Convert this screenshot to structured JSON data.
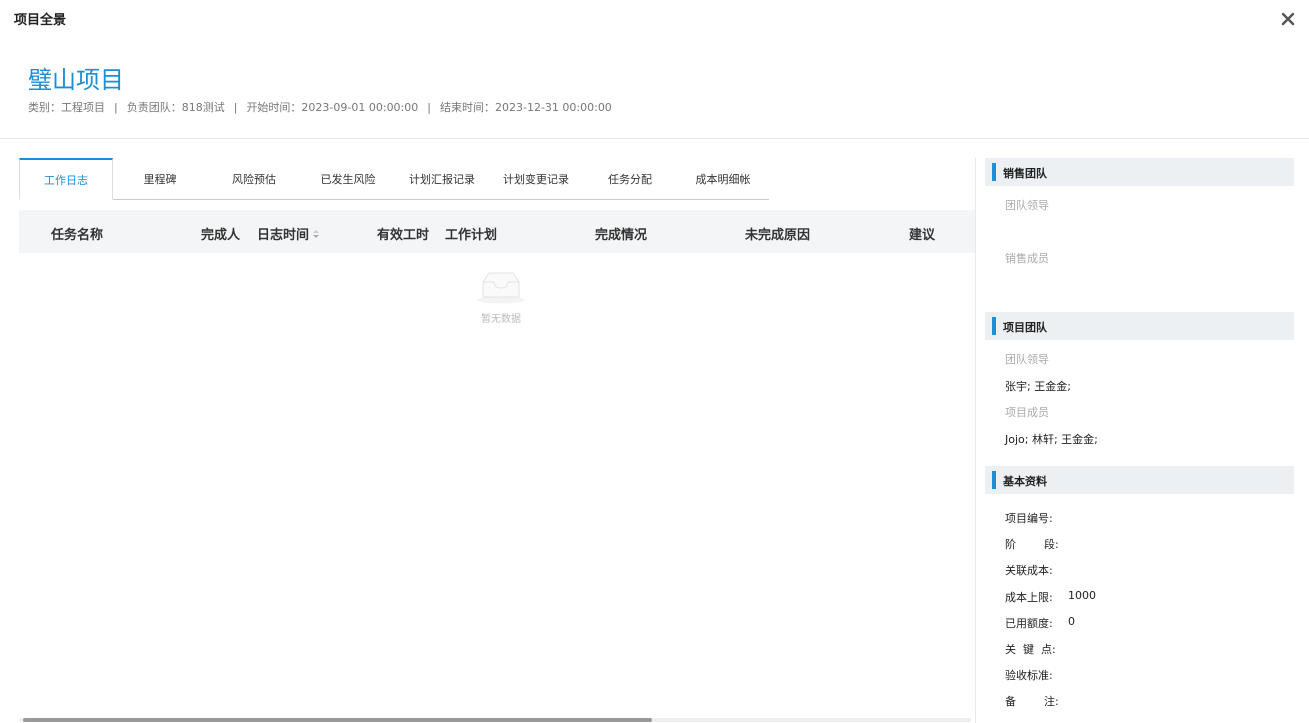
{
  "modal": {
    "title": "项目全景"
  },
  "project": {
    "name": "璧山项目",
    "meta": [
      "类别：工程项目",
      "负责团队：818测试",
      "开始时间：2023-09-01 00:00:00",
      "结束时间：2023-12-31 00:00:00"
    ],
    "separator": "|"
  },
  "tabs": [
    "工作日志",
    "里程碑",
    "风险预估",
    "已发生风险",
    "计划汇报记录",
    "计划变更记录",
    "任务分配",
    "成本明细帐"
  ],
  "table": {
    "columns": [
      "任务名称",
      "完成人",
      "日志时间",
      "有效工时",
      "工作计划",
      "完成情况",
      "未完成原因",
      "建议"
    ],
    "empty_text": "暂无数据"
  },
  "sidebar": {
    "sales_team": {
      "title": "销售团队",
      "leader_label": "团队领导",
      "leader_value": "",
      "members_label": "销售成员",
      "members_value": ""
    },
    "project_team": {
      "title": "项目团队",
      "leader_label": "团队领导",
      "leader_value": "张宇; 王金金;",
      "members_label": "项目成员",
      "members_value": "Jojo; 林轩; 王金金;"
    },
    "basic_info": {
      "title": "基本资料",
      "fields": [
        {
          "key": "项目编号:",
          "value": ""
        },
        {
          "key": "阶        段:",
          "value": ""
        },
        {
          "key": "关联成本:",
          "value": ""
        },
        {
          "key": "成本上限:",
          "value": "1000"
        },
        {
          "key": "已用额度:",
          "value": "0"
        },
        {
          "key": "关  键  点:",
          "value": ""
        },
        {
          "key": "验收标准:",
          "value": ""
        },
        {
          "key": "备        注:",
          "value": ""
        }
      ]
    }
  },
  "colors": {
    "accent": "#1a8fd8",
    "section_bg": "#edf0f3",
    "table_head_bg": "#f3f5f7"
  }
}
